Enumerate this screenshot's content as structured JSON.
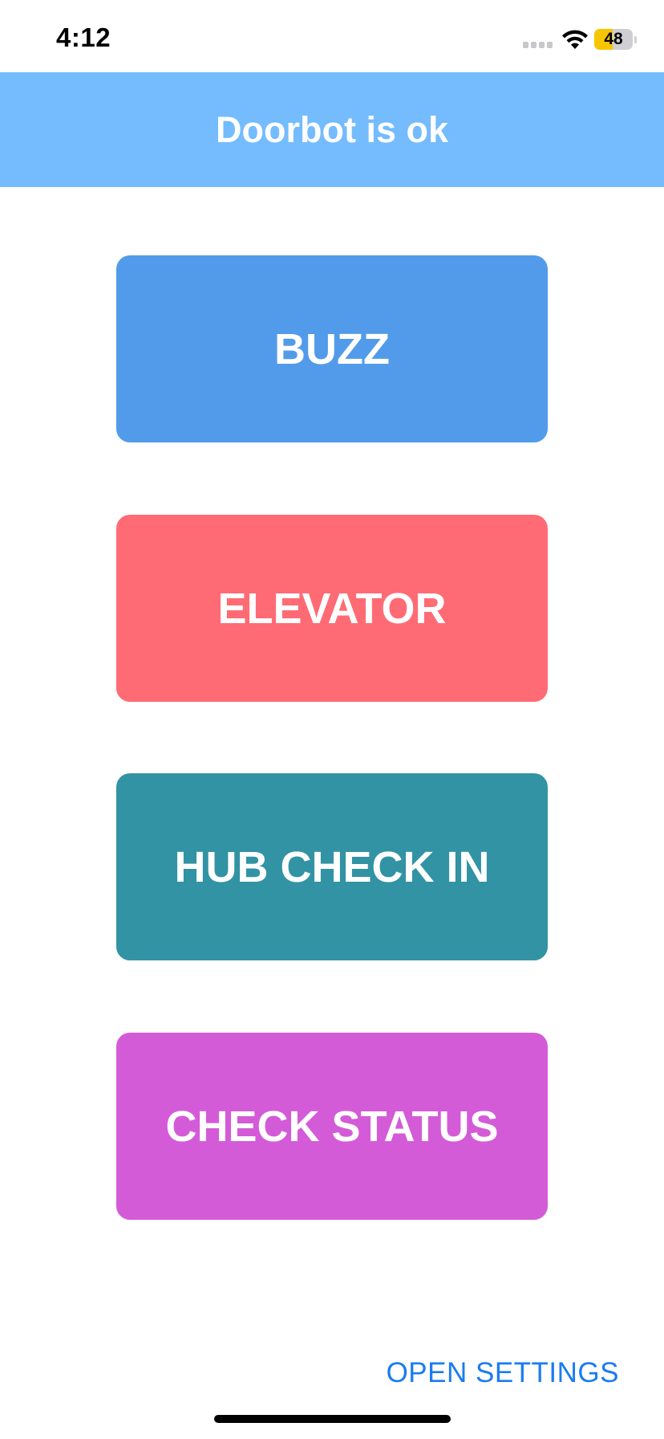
{
  "status_bar": {
    "time": "4:12",
    "battery_label": "48",
    "battery_level": 0.48,
    "battery_color": "#f7c600",
    "icons": [
      "signal-icon",
      "wifi-icon",
      "battery-icon"
    ]
  },
  "header": {
    "title": "Doorbot is ok",
    "background": "#74bcfd"
  },
  "buttons": [
    {
      "label": "BUZZ",
      "color": "#529bea"
    },
    {
      "label": "ELEVATOR",
      "color": "#ff6b74"
    },
    {
      "label": "HUB CHECK IN",
      "color": "#3193a4"
    },
    {
      "label": "CHECK STATUS",
      "color": "#d45bd8"
    }
  ],
  "footer": {
    "settings_label": "OPEN SETTINGS",
    "link_color": "#1a7cf2"
  }
}
